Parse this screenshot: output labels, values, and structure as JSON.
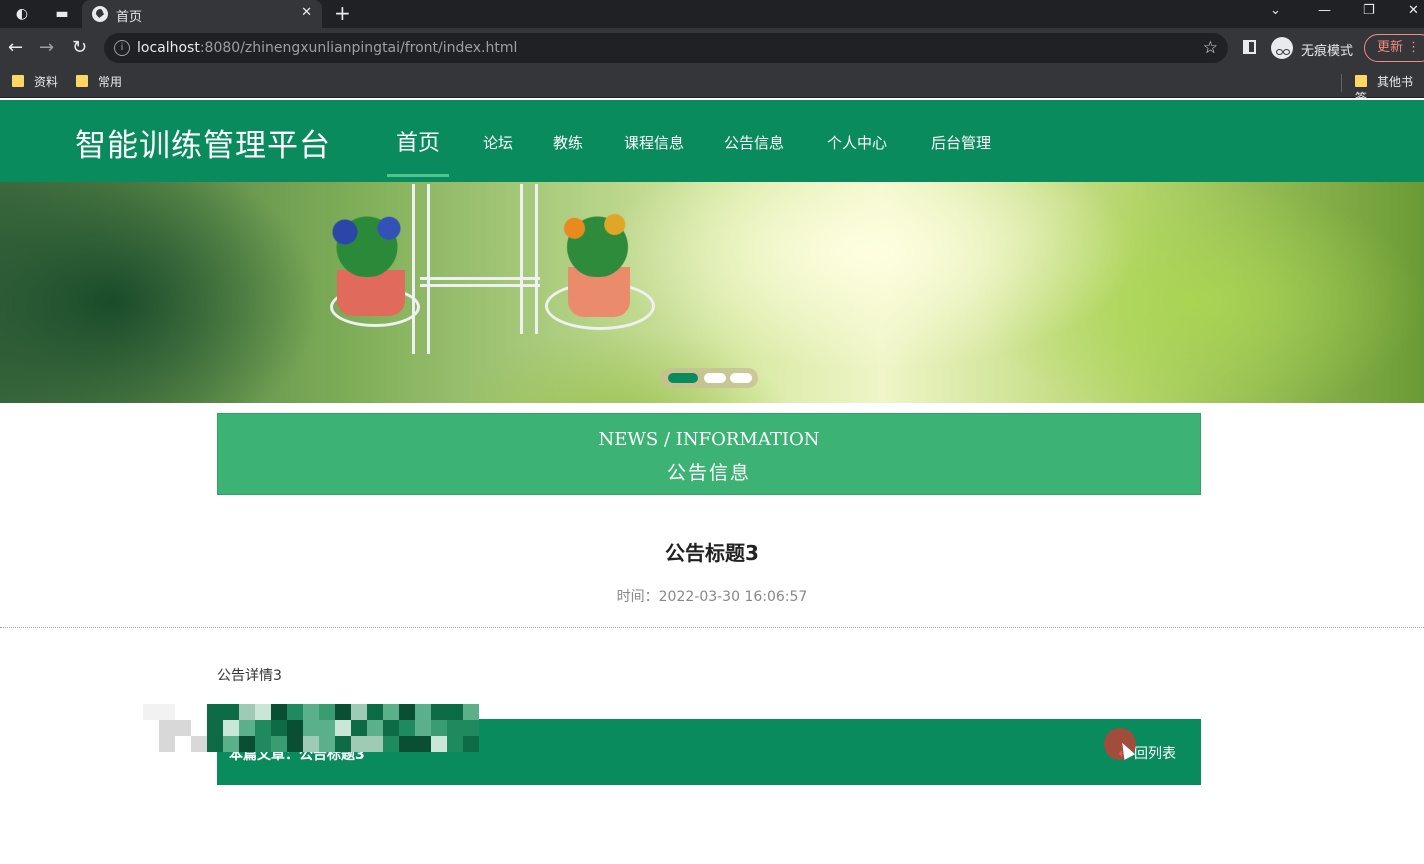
{
  "browser": {
    "tab_title": "首页",
    "url_host": "localhost",
    "url_path": ":8080/zhinengxunlianpingtai/front/index.html",
    "incognito_label": "无痕模式",
    "update_label": "更新",
    "bookmarks": [
      {
        "label": "资料"
      },
      {
        "label": "常用"
      },
      {
        "label": "其他书签"
      }
    ]
  },
  "site": {
    "title": "智能训练管理平台",
    "nav": [
      {
        "label": "首页",
        "active": true
      },
      {
        "label": "论坛"
      },
      {
        "label": "教练"
      },
      {
        "label": "课程信息"
      },
      {
        "label": "公告信息"
      },
      {
        "label": "个人中心"
      },
      {
        "label": "后台管理"
      }
    ]
  },
  "banner": {
    "slide_count": 3,
    "active_slide": 1
  },
  "section": {
    "en_title": "NEWS / INFORMATION",
    "cn_title": "公告信息"
  },
  "article": {
    "title": "公告标题3",
    "time": "时间：2022-03-30 16:06:57",
    "body": "公告详情3"
  },
  "pager": {
    "current_label": "本篇文章：公告标题3",
    "back_label": "回列表"
  },
  "colors": {
    "brand": "#0a8b5e",
    "section_box": "#3cb274"
  }
}
